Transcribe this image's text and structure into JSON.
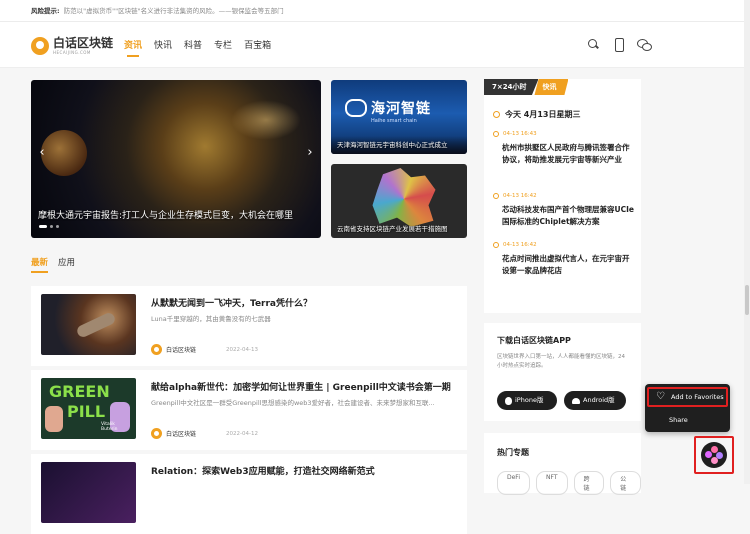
{
  "risk": {
    "label": "风险提示:",
    "text": "防范以\"虚拟货币\"\"区块链\"名义进行非法集资的风险。——银保监会等五部门"
  },
  "header": {
    "logo_cn": "白话区块链",
    "logo_en": "HECAIJING.COM",
    "nav": [
      {
        "label": "资讯",
        "active": true
      },
      {
        "label": "快讯",
        "active": false
      },
      {
        "label": "科普",
        "active": false
      },
      {
        "label": "专栏",
        "active": false
      },
      {
        "label": "百宝箱",
        "active": false
      }
    ],
    "icons": [
      "search-icon",
      "phone-icon",
      "wechat-icon"
    ]
  },
  "hero": {
    "caption": "摩根大通元宇宙报告:打工人与企业生存模式巨变，大机会在哪里",
    "prev": "‹",
    "next": "›",
    "dots": 3,
    "active_dot": 1
  },
  "tiles": [
    {
      "caption": "天津海河智链元宇宙科创中心正式成立",
      "brand_cn": "海河智链",
      "brand_en": "Haihe smart chain"
    },
    {
      "caption": "云南省支持区块链产业发展若干措施图"
    }
  ],
  "content_tabs": [
    {
      "label": "最新",
      "active": true
    },
    {
      "label": "应用",
      "active": false
    }
  ],
  "articles": [
    {
      "title": "从默默无闻到一飞冲天，Terra凭什么？",
      "desc": "Luna千里穿越的，其由黄鲁没有的七武器",
      "author": "白话区块链",
      "date": "2022-04-13"
    },
    {
      "title": "献给alpha新世代：加密学如何让世界重生 | Greenpill中文读书会第一期...",
      "desc": "Greenpill中文社区是一群受Greenpill思想感染的web3爱好者，社会建设者、未来梦想家和互联...",
      "author": "白话区块链",
      "date": "2022-04-12",
      "thumb_text": [
        "GREEN",
        "PILL",
        "Vitalik Buterin"
      ]
    },
    {
      "title": "Relation：探索Web3应用赋能，打造社交网络新范式",
      "desc": "",
      "author": "",
      "date": ""
    }
  ],
  "flash": {
    "tab1": "7×24小时",
    "tab2": "快讯",
    "today": "今天 4月13日星期三",
    "items": [
      {
        "time": "04-13 16:43",
        "text": "杭州市拱墅区人民政府与腾讯签署合作协议，将助推发展元宇宙等新兴产业"
      },
      {
        "time": "04-13 16:42",
        "text": "芯动科技发布国产首个物理层兼容UCIe国际标准的Chiplet解决方案"
      },
      {
        "time": "04-13 16:42",
        "text": "花点时间推出虚拟代言人，在元宇宙开设第一家品牌花店"
      }
    ]
  },
  "app": {
    "title": "下载白话区块链APP",
    "desc": "区块链世界入口第一站，人人都能看懂的区块链，24 小时热点实时追踪。",
    "ios_label": "iPhone版",
    "android_label": "Android版"
  },
  "topics": {
    "title": "热门专题",
    "chips": [
      "DeFi",
      "NFT",
      "跨链",
      "公链"
    ]
  },
  "popup": {
    "favorite_label": "Add to Favorites",
    "share_label": "Share"
  }
}
